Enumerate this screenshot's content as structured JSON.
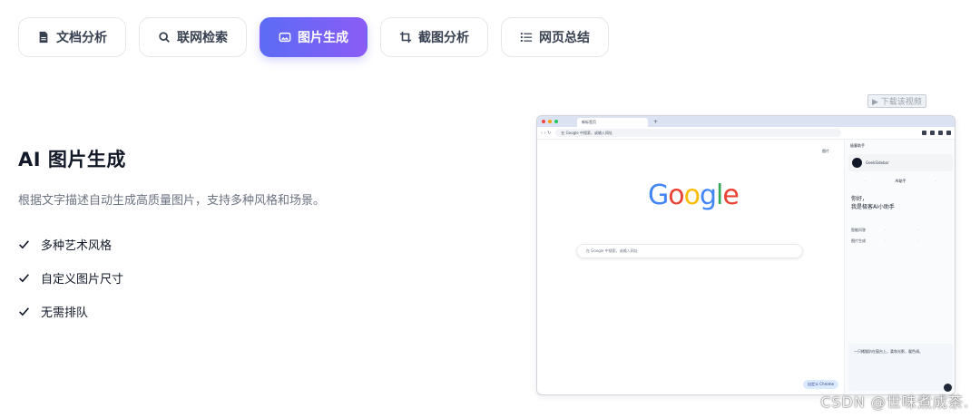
{
  "tabs": [
    {
      "label": "文档分析",
      "icon": "document-icon",
      "active": false
    },
    {
      "label": "联网检索",
      "icon": "search-icon",
      "active": false
    },
    {
      "label": "图片生成",
      "icon": "image-icon",
      "active": true
    },
    {
      "label": "截图分析",
      "icon": "crop-icon",
      "active": false
    },
    {
      "label": "网页总结",
      "icon": "list-icon",
      "active": false
    }
  ],
  "section": {
    "title": "AI 图片生成",
    "description": "根据文字描述自动生成高质量图片，支持多种风格和场景。",
    "features": [
      "多种艺术风格",
      "自定义图片尺寸",
      "无需排队"
    ]
  },
  "browser": {
    "tab_title": "新标签页",
    "address": "在 Google 中搜索，或输入网址",
    "images_link": "图片",
    "logo": "Google",
    "search_placeholder": "在 Google 中搜索，或输入网址",
    "customize_label": "自定义 Chrome",
    "sidebar": {
      "header": "极客助手",
      "user": "GeekSidebar",
      "tab_active": "AI助手",
      "greeting_line1": "你好，",
      "greeting_line2": "我是极客AI小助手",
      "grid": [
        "智能问答",
        "",
        "",
        "图片生成",
        "",
        ""
      ],
      "input_text": "一只橘猫趴在窗台上，柔和光影，暖色调。"
    }
  },
  "video_badge": "▶ 下载该视频",
  "watermark": "CSDN @世味煮成茶.",
  "colors": {
    "accent_start": "#5b6cf5",
    "accent_end": "#8b5cf6"
  }
}
